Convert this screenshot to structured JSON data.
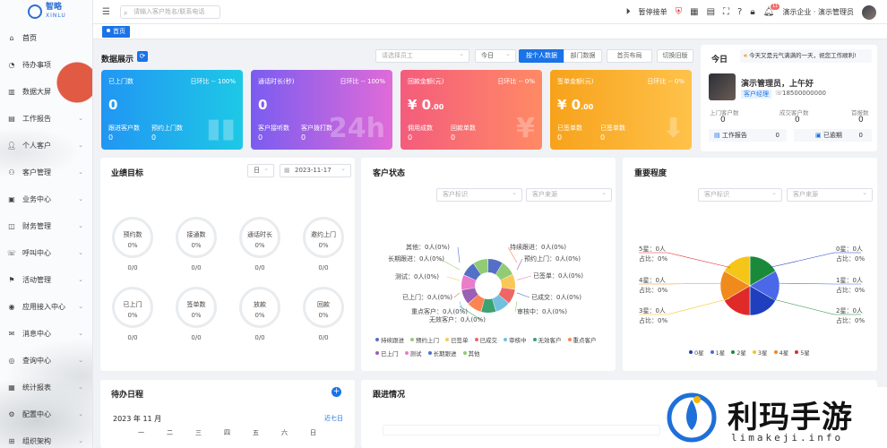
{
  "logo": {
    "name": "智略",
    "sub": "XINLU"
  },
  "search": {
    "placeholder": "请输入客户姓名/联系电话"
  },
  "menu": [
    {
      "label": "首页",
      "icon": "home-icon",
      "chev": false
    },
    {
      "label": "待办事项",
      "icon": "clock-icon",
      "chev": false
    },
    {
      "label": "数据大屏",
      "icon": "bar-chart-icon",
      "chev": false
    },
    {
      "label": "工作报告",
      "icon": "report-icon",
      "chev": true
    },
    {
      "label": "个人客户",
      "icon": "user-icon",
      "chev": true
    },
    {
      "label": "客户管理",
      "icon": "users-icon",
      "chev": true
    },
    {
      "label": "业务中心",
      "icon": "briefcase-icon",
      "chev": true
    },
    {
      "label": "财务管理",
      "icon": "wallet-icon",
      "chev": true
    },
    {
      "label": "呼叫中心",
      "icon": "phone-icon",
      "chev": true
    },
    {
      "label": "活动管理",
      "icon": "flag-icon",
      "chev": true
    },
    {
      "label": "应用接入中心",
      "icon": "app-icon",
      "chev": true
    },
    {
      "label": "消息中心",
      "icon": "message-icon",
      "chev": true
    },
    {
      "label": "查询中心",
      "icon": "query-icon",
      "chev": true
    },
    {
      "label": "统计报表",
      "icon": "stats-icon",
      "chev": true
    },
    {
      "label": "配置中心",
      "icon": "config-icon",
      "chev": true
    },
    {
      "label": "组织架构",
      "icon": "org-icon",
      "chev": true
    }
  ],
  "topbar": {
    "pause": "暂停接单",
    "badge": "11",
    "company": "演示企业 · 演示管理员"
  },
  "tabs": {
    "home": "首页"
  },
  "data_show": {
    "title": "数据展示",
    "staff_placeholder": "请选择员工",
    "period": "今日",
    "buttons": [
      "按个人数据",
      "部门数据",
      "首页布局",
      "切换旧版"
    ],
    "cards": [
      {
        "title": "已上门数",
        "ratio": "日环比 -- 100%",
        "value": "0",
        "value_suffix": "",
        "s1": "跟进客户数",
        "s2": "预约上门数",
        "v1": "0",
        "v2": "0",
        "color1": "#2196f3",
        "color2": "#1ec8e6",
        "deco": "▮▮"
      },
      {
        "title": "通话时长(秒)",
        "ratio": "日环比 -- 100%",
        "value": "0",
        "value_suffix": "",
        "s1": "客户接听数",
        "s2": "客户拨打数",
        "v1": "0",
        "v2": "0",
        "color1": "#7a5cf0",
        "color2": "#e06bd8",
        "deco": "24h"
      },
      {
        "title": "回款金额(元)",
        "ratio": "日环比 -- 0%",
        "value": "¥ 0",
        "value_suffix": ".00",
        "s1": "佣用成数",
        "s2": "回款单数",
        "v1": "0",
        "v2": "0",
        "color1": "#f45c7c",
        "color2": "#ff8a65",
        "deco": "¥"
      },
      {
        "title": "签单金额(元)",
        "ratio": "日环比 -- 0%",
        "value": "¥ 0",
        "value_suffix": ".00",
        "s1": "已签单数",
        "s2": "已签单数",
        "v1": "0",
        "v2": "0",
        "color1": "#f7a21b",
        "color2": "#ffc24a",
        "deco": "⬇"
      }
    ]
  },
  "today": {
    "title": "今日",
    "notice": "今天又是元气满满的一天，祝您工作顺利!",
    "greeting": "演示管理员，上午好",
    "role": "客户经理",
    "phone": "18500000000",
    "stats": [
      {
        "label": "上门客户数",
        "value": "0"
      },
      {
        "label": "成交客户数",
        "value": "0"
      },
      {
        "label": "首报数",
        "value": "0"
      }
    ],
    "work_report": "工作报告",
    "work_report_n": "0",
    "overdue": "已逾期",
    "overdue_n": "0"
  },
  "perf": {
    "title": "业绩目标",
    "unit": "日",
    "date": "2023-11-17",
    "items": [
      {
        "label": "预约数",
        "pct": "0%",
        "val": "0/0"
      },
      {
        "label": "接通数",
        "pct": "0%",
        "val": "0/0"
      },
      {
        "label": "通话时长",
        "pct": "0%",
        "val": "0/0"
      },
      {
        "label": "邀约上门",
        "pct": "0%",
        "val": "0/0"
      },
      {
        "label": "已上门",
        "pct": "0%",
        "val": "0/0"
      },
      {
        "label": "签单数",
        "pct": "0%",
        "val": "0/0"
      },
      {
        "label": "放款",
        "pct": "0%",
        "val": "0/0"
      },
      {
        "label": "回款",
        "pct": "0%",
        "val": "0/0"
      }
    ]
  },
  "cust_status": {
    "title": "客户状态",
    "sel1": "客户标识",
    "sel2": "客户来源",
    "labels": [
      {
        "t": "其他：0人(0%)"
      },
      {
        "t": "长期跟进：0人(0%)"
      },
      {
        "t": "测试：0人(0%)"
      },
      {
        "t": "已上门：0人(0%)"
      },
      {
        "t": "重点客户：0人(0%)"
      },
      {
        "t": "无效客户：0人(0%)"
      },
      {
        "t": "持续跟进：0人(0%)"
      },
      {
        "t": "预约上门：0人(0%)"
      },
      {
        "t": "已签单：0人(0%)"
      },
      {
        "t": "已成交：0人(0%)"
      },
      {
        "t": "审核中：0人(0%)"
      }
    ],
    "legend1": [
      "持续跟进",
      "预约上门",
      "已签单",
      "已成交",
      "审核中",
      "无效客户",
      "重点客户"
    ],
    "legend2": [
      "已上门",
      "测试",
      "长期跟进",
      "其他"
    ],
    "colors": [
      "#5470c6",
      "#91cc75",
      "#fac858",
      "#ee6666",
      "#73c0de",
      "#3ba272",
      "#fc8452",
      "#9a60b4",
      "#ea7ccc",
      "#5470c6",
      "#91cc75"
    ]
  },
  "importance": {
    "title": "重要程度",
    "sel1": "客户标识",
    "sel2": "客户来源",
    "left": [
      {
        "n": "5星：0人",
        "p": "占比：0%"
      },
      {
        "n": "4星：0人",
        "p": "占比：0%"
      },
      {
        "n": "3星：0人",
        "p": "占比：0%"
      }
    ],
    "right": [
      {
        "n": "0星：0人",
        "p": "占比：0%"
      },
      {
        "n": "1星：0人",
        "p": "占比：0%"
      },
      {
        "n": "2星：0人",
        "p": "占比：0%"
      }
    ],
    "legend": [
      "0星",
      "1星",
      "2星",
      "3星",
      "4星",
      "5星"
    ],
    "colors": [
      "#1f3fbf",
      "#4a68e8",
      "#1a8a3a",
      "#f5c518",
      "#f08a1c",
      "#e02a2a"
    ]
  },
  "schedule": {
    "title": "待办日程",
    "month": "2023 年 11 月",
    "today": "近七日",
    "weekdays": [
      "一",
      "二",
      "三",
      "四",
      "五",
      "六",
      "日"
    ]
  },
  "follow": {
    "title": "跟进情况"
  },
  "watermark": {
    "title": "利玛手游",
    "url": "limakeji.info"
  }
}
